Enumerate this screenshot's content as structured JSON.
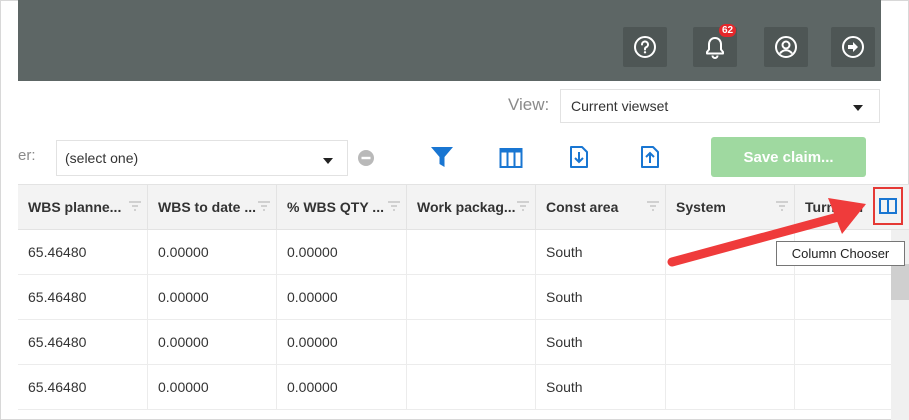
{
  "header": {
    "notifications_count": "62",
    "icons": [
      "help-icon",
      "bell-icon",
      "user-icon",
      "logout-icon"
    ]
  },
  "view": {
    "label": "View:",
    "selected": "Current viewset"
  },
  "filter": {
    "label": "er:",
    "selected": "(select one)"
  },
  "toolbar": {
    "save_label": "Save claim..."
  },
  "grid": {
    "columns": [
      "WBS planne...",
      "WBS to date ...",
      "% WBS QTY ...",
      "Work packag...",
      "Const area",
      "System",
      "Turnover"
    ],
    "rows": [
      [
        "65.46480",
        "0.00000",
        "0.00000",
        "",
        "South",
        "",
        ""
      ],
      [
        "65.46480",
        "0.00000",
        "0.00000",
        "",
        "South",
        "",
        ""
      ],
      [
        "65.46480",
        "0.00000",
        "0.00000",
        "",
        "South",
        "",
        ""
      ],
      [
        "65.46480",
        "0.00000",
        "0.00000",
        "",
        "South",
        "",
        ""
      ]
    ]
  },
  "tooltip": {
    "text": "Column Chooser"
  },
  "colors": {
    "header_bg": "#5d6665",
    "save_button": "#9fd9a0",
    "accent_blue": "#1976d2",
    "highlight_red": "#e53935"
  }
}
